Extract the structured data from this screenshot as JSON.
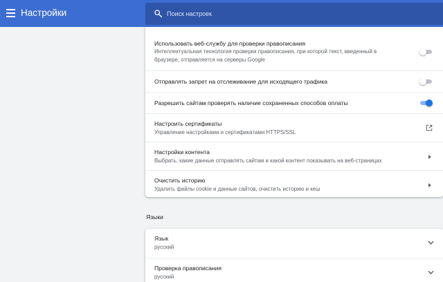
{
  "header": {
    "title": "Настройки",
    "menu_icon": "hamburger-menu-icon",
    "search_icon": "search-icon",
    "search_placeholder": "Поиск настроек"
  },
  "privacy_card": {
    "rows": [
      {
        "title": "Использовать веб-службу для проверки правописания",
        "sub1": "Интеллектуальная технология проверки правописания, при которой текст, введенный в",
        "sub2": "браузере, отправляется на серверы Google",
        "control": "toggle",
        "checked": false
      },
      {
        "title": "Отправлять запрет на отслеживание для исходящего трафика",
        "control": "toggle",
        "checked": false
      },
      {
        "title": "Разрешить сайтам проверять наличие сохраненных способов оплаты",
        "control": "toggle",
        "checked": true
      },
      {
        "title": "Настроить сертификаты",
        "sub1": "Управление настройками и сертификатами HTTPS/SSL",
        "control": "open-in-new-icon"
      },
      {
        "title": "Настройки контента",
        "sub1": "Выбрать, какие данные отправлять сайтам и какой контент показывать на веб-страницах",
        "control": "arrow-right-icon"
      },
      {
        "title": "Очистить историю",
        "sub1": "Удалить файлы cookie и данные сайтов, очистить историю и кеш",
        "control": "arrow-right-icon"
      }
    ]
  },
  "languages": {
    "heading": "Языки",
    "rows": [
      {
        "title": "Язык",
        "value": "русский",
        "control": "chevron-down-icon"
      },
      {
        "title": "Проверка правописания",
        "value": "русский",
        "control": "chevron-down-icon"
      }
    ]
  },
  "colors": {
    "header_bg": "#3c6dd0",
    "search_bg": "#2e55a8",
    "toggle_on": "#1a73e8",
    "page_bg": "#f1f3f4"
  }
}
